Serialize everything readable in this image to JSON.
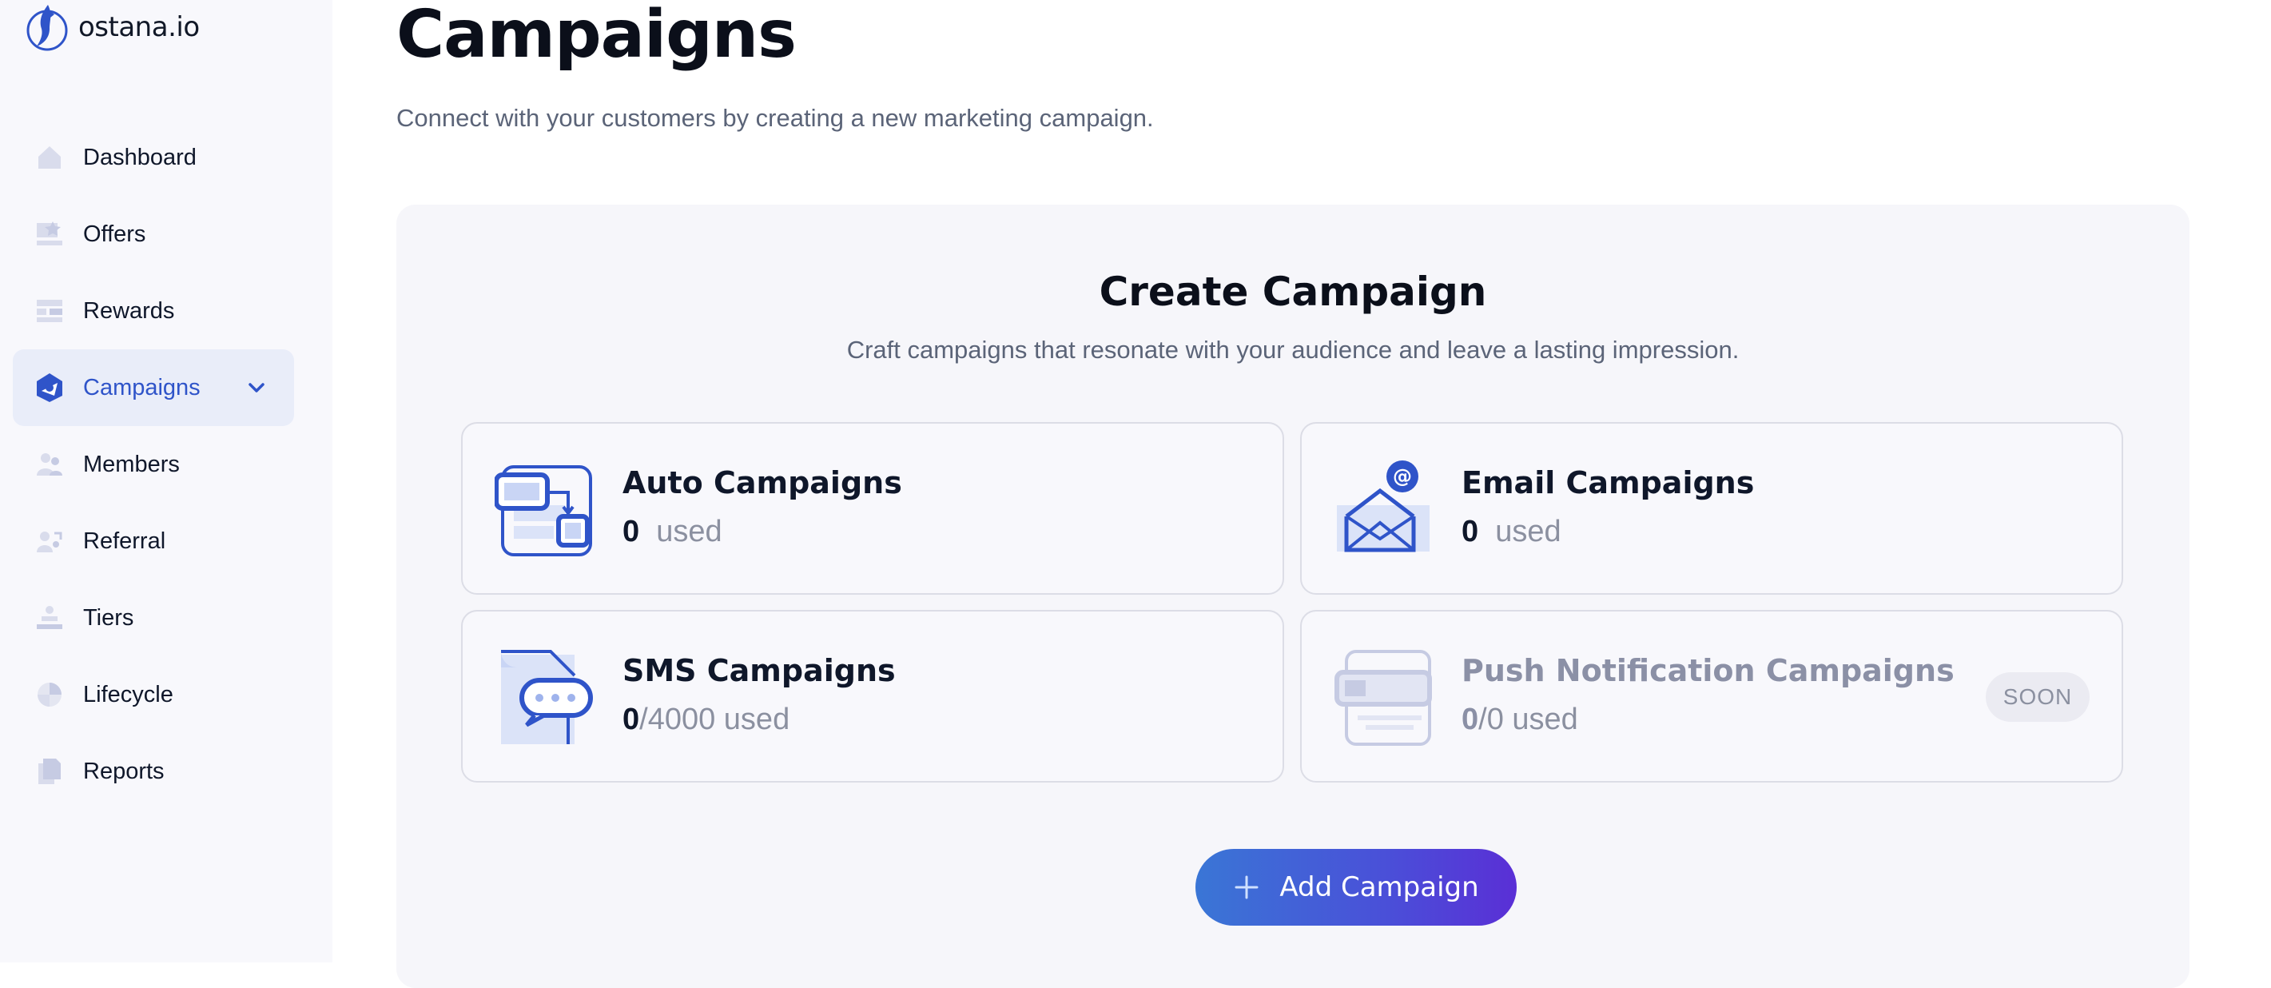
{
  "app": {
    "brand": "ostana.io"
  },
  "sidebar": {
    "items": [
      {
        "label": "Dashboard",
        "icon": "home-icon"
      },
      {
        "label": "Offers",
        "icon": "offers-icon"
      },
      {
        "label": "Rewards",
        "icon": "rewards-icon"
      },
      {
        "label": "Campaigns",
        "icon": "campaigns-icon",
        "active": true
      },
      {
        "label": "Members",
        "icon": "members-icon"
      },
      {
        "label": "Referral",
        "icon": "referral-icon"
      },
      {
        "label": "Tiers",
        "icon": "tiers-icon"
      },
      {
        "label": "Lifecycle",
        "icon": "lifecycle-icon"
      },
      {
        "label": "Reports",
        "icon": "reports-icon"
      }
    ]
  },
  "header": {
    "title": "Campaigns",
    "subtitle": "Connect with your customers by creating a new marketing campaign."
  },
  "create": {
    "title": "Create Campaign",
    "subtitle": "Craft campaigns that resonate with your audience and leave a lasting impression.",
    "cards": [
      {
        "title": "Auto Campaigns",
        "used": "0",
        "limit": "",
        "suffix": "used",
        "icon": "auto-campaign-icon"
      },
      {
        "title": "Email Campaigns",
        "used": "0",
        "limit": "",
        "suffix": "used",
        "icon": "email-campaign-icon"
      },
      {
        "title": "SMS Campaigns",
        "used": "0",
        "limit": "/4000",
        "suffix": "used",
        "icon": "sms-campaign-icon"
      },
      {
        "title": "Push Notification Campaigns",
        "used": "0",
        "limit": "/0",
        "suffix": "used",
        "icon": "push-campaign-icon",
        "badge": "SOON"
      }
    ],
    "add_button": "Add Campaign"
  },
  "colors": {
    "accent": "#2f54c9",
    "gradient_start": "#3a76d6",
    "gradient_end": "#5a2fd6"
  }
}
